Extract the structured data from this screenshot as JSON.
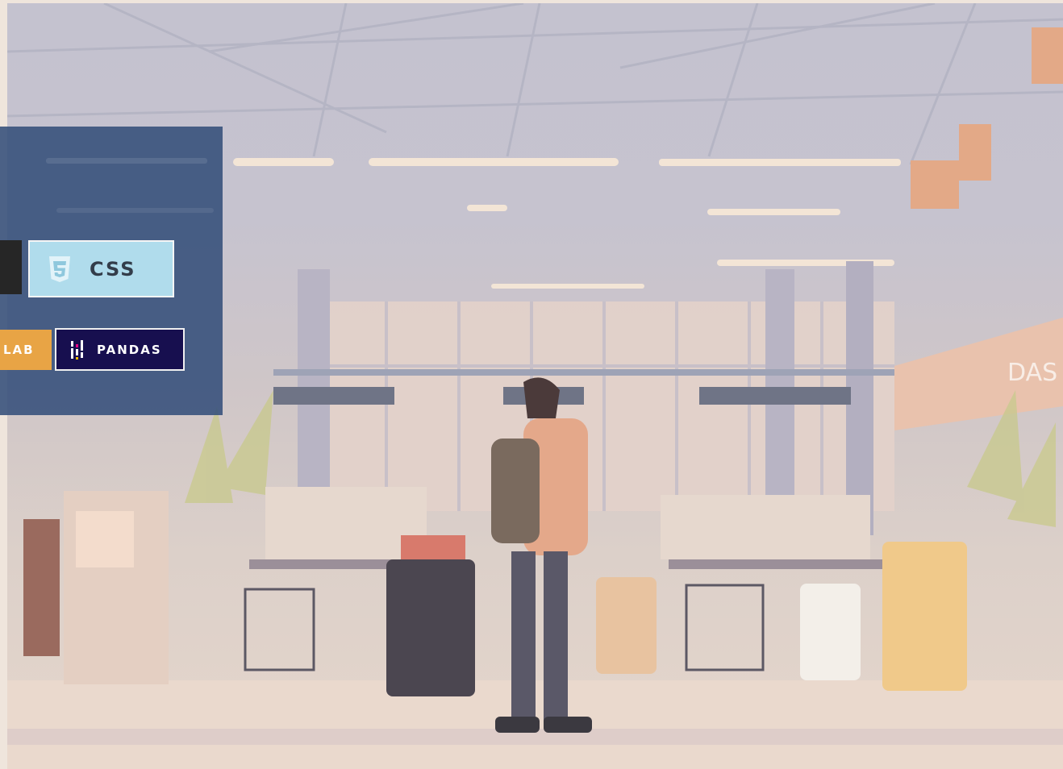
{
  "background": {
    "scene": "airport-terminal-illustration",
    "sign_text": "DAS"
  },
  "badges": {
    "css_label": "CSS",
    "lab_label": "LAB",
    "pandas_label": "PANDAS"
  },
  "colors": {
    "card": "#344e7a",
    "css_badge": "#b0dcec",
    "lab_badge": "#e8a445",
    "pandas_badge": "#170f4f",
    "dark_badge": "#262626"
  },
  "icons": {
    "css": "css3-shield-icon",
    "pandas": "pandas-bars-icon"
  }
}
